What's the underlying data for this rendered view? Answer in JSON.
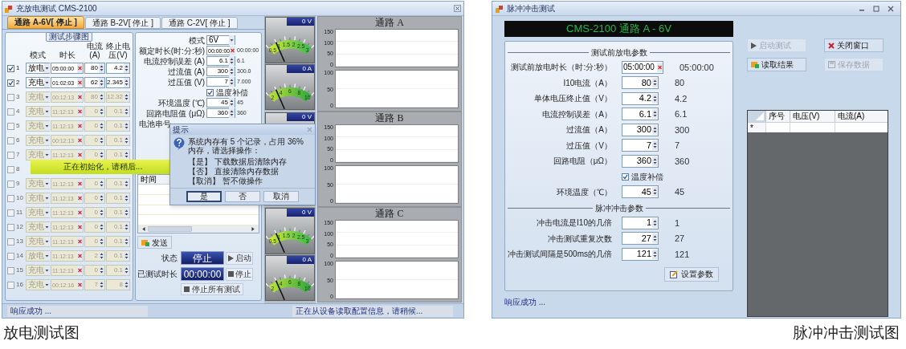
{
  "discharge_window": {
    "title": "充放电测试 CMS-2100",
    "tabs": [
      {
        "label": "通路 A-6V[ 停止 ]",
        "selected": true
      },
      {
        "label": "通路 B-2V[ 停止 ]",
        "selected": false
      },
      {
        "label": "通路 C-2V[ 停止 ]",
        "selected": false
      }
    ],
    "steps": {
      "group_label": "测试步骤图",
      "columns": [
        "模式",
        "时长",
        "电流(A)",
        "终止电压(V)"
      ],
      "rows": [
        {
          "number": "1",
          "checked": true,
          "enabled": true,
          "mode": "放电",
          "duration": "05:00:00",
          "current": "80",
          "voltage": "4.2"
        },
        {
          "number": "2",
          "checked": true,
          "enabled": true,
          "mode": "充电",
          "duration": "01:02:03",
          "current": "62",
          "voltage": "2.345"
        },
        {
          "number": "3",
          "checked": false,
          "enabled": false,
          "mode": "充电",
          "duration": "00:12:13",
          "current": "80",
          "voltage": "12.32"
        },
        {
          "number": "4",
          "checked": false,
          "enabled": false,
          "mode": "充电",
          "duration": "11:12:13",
          "current": "0",
          "voltage": "0.1"
        },
        {
          "number": "5",
          "checked": false,
          "enabled": false,
          "mode": "充电",
          "duration": "11:12:13",
          "current": "0",
          "voltage": "0.1"
        },
        {
          "number": "6",
          "checked": false,
          "enabled": false,
          "mode": "充电",
          "duration": "00:12:13",
          "current": "0",
          "voltage": "0.1"
        },
        {
          "number": "7",
          "checked": false,
          "enabled": false,
          "mode": "充电",
          "duration": "11:12:13",
          "current": "0",
          "voltage": "0.1"
        },
        {
          "number": "8",
          "checked": false,
          "enabled": false
        },
        {
          "number": "9",
          "checked": false,
          "enabled": false,
          "mode": "充电",
          "duration": "11:12:13",
          "current": "0",
          "voltage": "0.1"
        },
        {
          "number": "10",
          "checked": false,
          "enabled": false,
          "mode": "充电",
          "duration": "11:12:13",
          "current": "0",
          "voltage": "0.1"
        },
        {
          "number": "11",
          "checked": false,
          "enabled": false,
          "mode": "充电",
          "duration": "11:12:13",
          "current": "0",
          "voltage": "0.1"
        },
        {
          "number": "12",
          "checked": false,
          "enabled": false,
          "mode": "充电",
          "duration": "11:12:13",
          "current": "0",
          "voltage": "0.1"
        },
        {
          "number": "13",
          "checked": false,
          "enabled": false,
          "mode": "充电",
          "duration": "11:12:13",
          "current": "0",
          "voltage": "0.1"
        },
        {
          "number": "14",
          "checked": false,
          "enabled": false,
          "mode": "放电",
          "duration": "11:12:13",
          "current": "2",
          "voltage": "0.1"
        },
        {
          "number": "15",
          "checked": false,
          "enabled": false,
          "mode": "充电",
          "duration": "11:12:13",
          "current": "0",
          "voltage": "0.1"
        },
        {
          "number": "16",
          "checked": false,
          "enabled": false,
          "mode": "充电",
          "duration": "00:12:16",
          "current": "7",
          "voltage": "8"
        }
      ]
    },
    "settings": {
      "fields": [
        {
          "kind": "combo",
          "label": "模式",
          "value": "6V"
        },
        {
          "kind": "time",
          "label": "额定时长(时:分:秒)",
          "value": "00:00:00",
          "reading": "00:00:00"
        },
        {
          "kind": "spin",
          "label": "电流控制误差 (A)",
          "value": "6.1",
          "reading": "6.1"
        },
        {
          "kind": "spin",
          "label": "过流值 (A)",
          "value": "300",
          "reading": "300.0"
        },
        {
          "kind": "spin",
          "label": "过压值 (V)",
          "value": "7",
          "reading": "7.000"
        },
        {
          "kind": "checkbox",
          "label": "温度补偿",
          "checked": true
        },
        {
          "kind": "spin",
          "label": "环境温度 (℃)",
          "value": "45",
          "reading": "45"
        },
        {
          "kind": "spin",
          "label": "回路电阻值 (μΩ)",
          "value": "360",
          "reading": "360"
        },
        {
          "kind": "label",
          "label": "电池串号"
        }
      ],
      "log": {
        "columns": [
          "时间"
        ]
      },
      "send_button": "发送",
      "status_label": "状态",
      "status_value": "停止",
      "start_button": "启动",
      "elapsed_label": "已测试时长",
      "elapsed_value": "00:00:00",
      "stop_button": "停止",
      "stop_all_button": "停止所有测试"
    },
    "channels": [
      {
        "title": "通路 A",
        "gauges": [
          {
            "kind": "voltage",
            "readout": "0 V",
            "scale": [
              "0.5",
              "1",
              "1.5",
              "2",
              "2.5",
              "3"
            ]
          },
          {
            "kind": "current",
            "readout": "0 A",
            "scale": [
              "2",
              "4",
              "6",
              "8",
              "10"
            ]
          }
        ],
        "plots": [
          {
            "y_ticks": [
              "150",
              "100",
              "50",
              "0"
            ]
          },
          {
            "y_ticks": [
              "100",
              "50",
              "0"
            ]
          }
        ]
      },
      {
        "title": "通路 B",
        "gauges": [
          {
            "kind": "voltage",
            "readout": "0 V"
          }
        ],
        "plots": [
          {
            "y_ticks": [
              "150",
              "100",
              "50",
              "0"
            ]
          },
          {
            "y_ticks": [
              "100",
              "50",
              "0"
            ]
          }
        ]
      },
      {
        "title": "通路 C",
        "gauges": [
          {
            "kind": "voltage",
            "readout": "0 V",
            "scale": [
              "0.5",
              "1",
              "1.5",
              "2",
              "2.5",
              "3"
            ]
          },
          {
            "kind": "current",
            "readout": "0 A",
            "scale": [
              "2",
              "4",
              "6",
              "8",
              "10"
            ]
          }
        ],
        "plots": [
          {
            "y_ticks": [
              "150",
              "100",
              "50",
              "0"
            ]
          },
          {
            "y_ticks": [
              "100",
              "50",
              "0"
            ]
          }
        ]
      }
    ],
    "loading_banner": "正在初始化，请稍后...",
    "dialog": {
      "title": "提示",
      "message": "系统内存有 5 个记录，占用 36% 内存，请选择操作：",
      "options": [
        "【是】 下载数据后清除内存",
        "【否】 直接清除内存数据",
        "【取消】 暂不做操作"
      ],
      "buttons": [
        {
          "label": "是",
          "selected": true
        },
        {
          "label": "否",
          "selected": false
        },
        {
          "label": "取消",
          "selected": false
        }
      ]
    },
    "status_left": "响应成功 ...",
    "status_right": "正在从设备读取配置信息，请稍候..."
  },
  "pulse_window": {
    "title": "脉冲冲击测试",
    "banner": "CMS-2100 通路 A - 6V",
    "sections": [
      {
        "title": "测试前放电参数",
        "fields": [
          {
            "kind": "time",
            "label": "测试前放电时长（时:分:秒）",
            "value": "05:00:00",
            "reading": "05:00:00"
          },
          {
            "kind": "spin",
            "label": "I10电流（A）",
            "value": "80",
            "reading": "80"
          },
          {
            "kind": "spin",
            "label": "单体电压终止值（V）",
            "value": "4.2",
            "reading": "4.2"
          },
          {
            "kind": "spin",
            "label": "电流控制误差（A）",
            "value": "6.1",
            "reading": "6.1"
          },
          {
            "kind": "spin",
            "label": "过流值（A）",
            "value": "300",
            "reading": "300"
          },
          {
            "kind": "spin",
            "label": "过压值（V）",
            "value": "7",
            "reading": "7"
          },
          {
            "kind": "spin",
            "label": "回路电阻（μΩ）",
            "value": "360",
            "reading": "360"
          },
          {
            "kind": "checkbox",
            "label": "温度补偿",
            "checked": true
          },
          {
            "kind": "spin",
            "label": "环境温度（℃）",
            "value": "45",
            "reading": "45"
          }
        ]
      },
      {
        "title": "脉冲冲击参数",
        "fields": [
          {
            "kind": "spin",
            "label": "冲击电流是I10的几倍",
            "value": "1",
            "reading": "1"
          },
          {
            "kind": "spin",
            "label": "冲击测试重复次数",
            "value": "27",
            "reading": "27"
          },
          {
            "kind": "spin",
            "label": "冲击测试间隔是500ms的几倍",
            "value": "121",
            "reading": "121"
          }
        ]
      }
    ],
    "set_button": "设置参数",
    "actions": [
      {
        "kind": "play",
        "label": "启动测试",
        "disabled": true
      },
      {
        "kind": "close",
        "label": "关闭窗口",
        "disabled": false
      },
      {
        "kind": "open",
        "label": "读取结果",
        "disabled": false
      },
      {
        "kind": "save",
        "label": "保存数据",
        "disabled": true
      }
    ],
    "grid": {
      "columns": [
        "序号",
        "电压(V)",
        "电流(A)"
      ],
      "new_row_marker": "*"
    },
    "status": "响应成功 ..."
  },
  "captions": [
    "放电测试图",
    "脉冲冲击测试图"
  ]
}
